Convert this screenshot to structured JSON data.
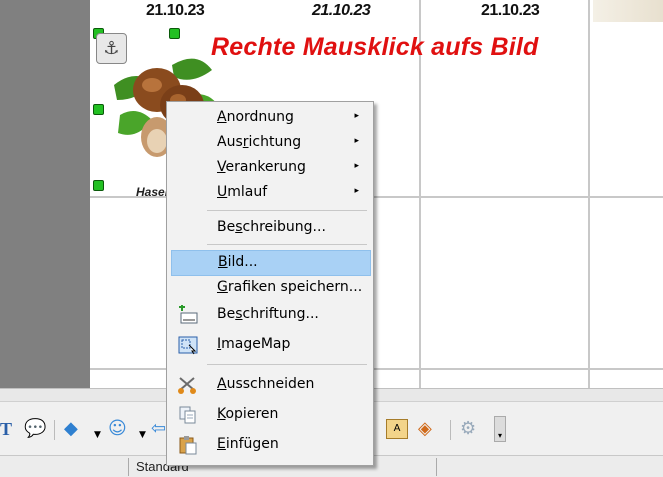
{
  "calendar": {
    "dates": [
      "21.10.23",
      "21.10.23",
      "21.10.23"
    ],
    "banner_text": "Rechte Mausklick aufs Bild",
    "cut_text": "Haselnuss"
  },
  "context_menu": {
    "items": [
      {
        "pre": "",
        "u": "A",
        "post": "nordnung",
        "submenu": true
      },
      {
        "pre": "Aus",
        "u": "r",
        "post": "ichtung",
        "submenu": true
      },
      {
        "pre": "",
        "u": "V",
        "post": "erankerung",
        "submenu": true
      },
      {
        "pre": "",
        "u": "U",
        "post": "mlauf",
        "submenu": true
      },
      {
        "pre": "Be",
        "u": "s",
        "post": "chreibung...",
        "submenu": false
      },
      {
        "pre": "",
        "u": "B",
        "post": "ild...",
        "submenu": false
      },
      {
        "pre": "",
        "u": "G",
        "post": "rafiken speichern...",
        "submenu": false
      },
      {
        "pre": "Be",
        "u": "s",
        "post": "chriftung...",
        "submenu": false
      },
      {
        "pre": "",
        "u": "I",
        "post": "mageMap",
        "submenu": false
      },
      {
        "pre": "",
        "u": "A",
        "post": "usschneiden",
        "submenu": false
      },
      {
        "pre": "",
        "u": "K",
        "post": "opieren",
        "submenu": false
      },
      {
        "pre": "",
        "u": "E",
        "post": "infügen",
        "submenu": false
      }
    ],
    "highlighted": "Bild...",
    "icons": [
      "caption-icon",
      "imagemap-icon",
      "scissors-icon",
      "copy-icon",
      "paste-icon"
    ]
  },
  "statusbar": {
    "page_style": "Standard"
  },
  "colors": {
    "banner": "#e01010",
    "highlight": "#a9d1f5",
    "handle": "#22c022"
  }
}
